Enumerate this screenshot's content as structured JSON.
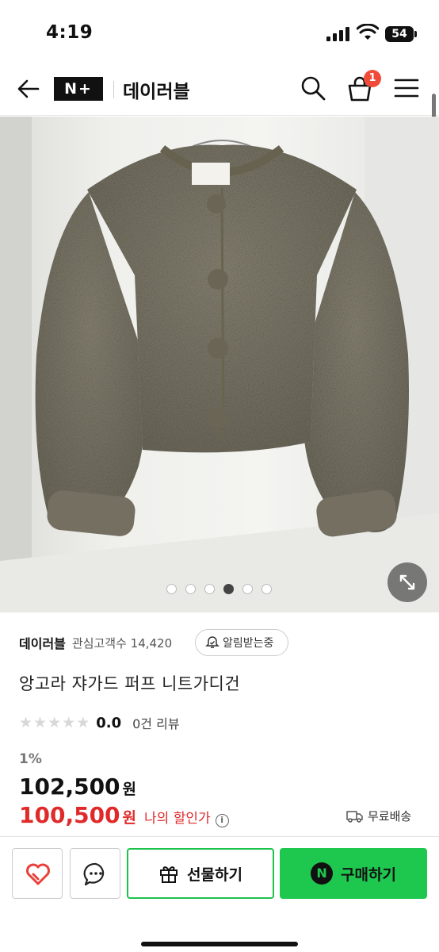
{
  "status_bar": {
    "time": "4:19",
    "battery": "54"
  },
  "header": {
    "logo_text": "N+",
    "store_name": "데이러블",
    "cart_count": "1"
  },
  "gallery": {
    "dot_count": 6,
    "active_dot_index": 3
  },
  "store": {
    "name": "데이러블",
    "fans_label": "관심고객수 14,420",
    "alarm_label": "알림받는중"
  },
  "product": {
    "title": "앙고라 쟈가드 퍼프 니트가디건",
    "rating_score": "0.0",
    "reviews_label": "0건 리뷰",
    "stars_filled": 0,
    "discount_rate": "1%",
    "original_price": "102,500",
    "sale_price": "100,500",
    "currency": "원",
    "my_discount_label": "나의 할인가",
    "info_glyph": "i",
    "shipping_label": "무료배송"
  },
  "bottom_bar": {
    "gift_label": "선물하기",
    "buy_label": "구매하기",
    "buy_icon_letter": "N"
  },
  "colors": {
    "accent_green": "#1ec84f",
    "sale_red": "#e02a2a",
    "badge_red": "#f04b3a"
  },
  "icons": [
    "back-arrow-icon",
    "search-icon",
    "cart-icon",
    "hamburger-menu-icon",
    "expand-icon",
    "bell-icon",
    "star-icon",
    "truck-icon",
    "heart-icon",
    "chat-icon",
    "gift-icon"
  ]
}
